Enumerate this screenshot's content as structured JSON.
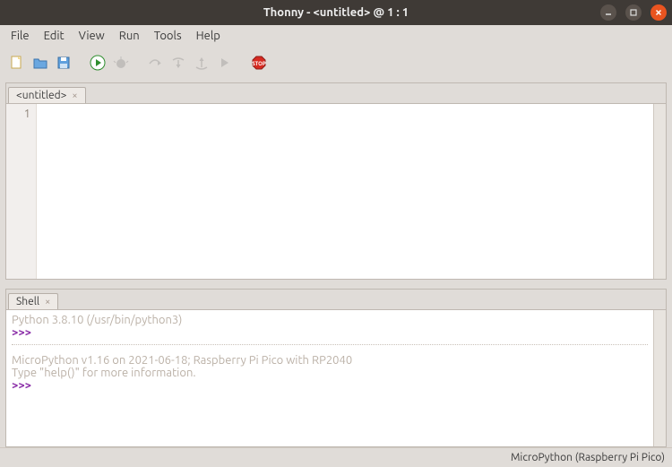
{
  "window": {
    "title": "Thonny  -  <untitled>  @  1 : 1"
  },
  "menu": {
    "file": "File",
    "edit": "Edit",
    "view": "View",
    "run": "Run",
    "tools": "Tools",
    "help": "Help"
  },
  "editor": {
    "tab_label": "<untitled>",
    "line_number": "1",
    "content": ""
  },
  "shell": {
    "tab_label": "Shell",
    "line1": "Python 3.8.10 (/usr/bin/python3)",
    "prompt": ">>>",
    "blank": " ",
    "mp_line1": "MicroPython v1.16 on 2021-06-18; Raspberry Pi Pico with RP2040",
    "mp_line2": "Type \"help()\" for more information."
  },
  "status": {
    "interpreter": "MicroPython (Raspberry Pi Pico)"
  },
  "glyph": {
    "tab_close": "×"
  }
}
